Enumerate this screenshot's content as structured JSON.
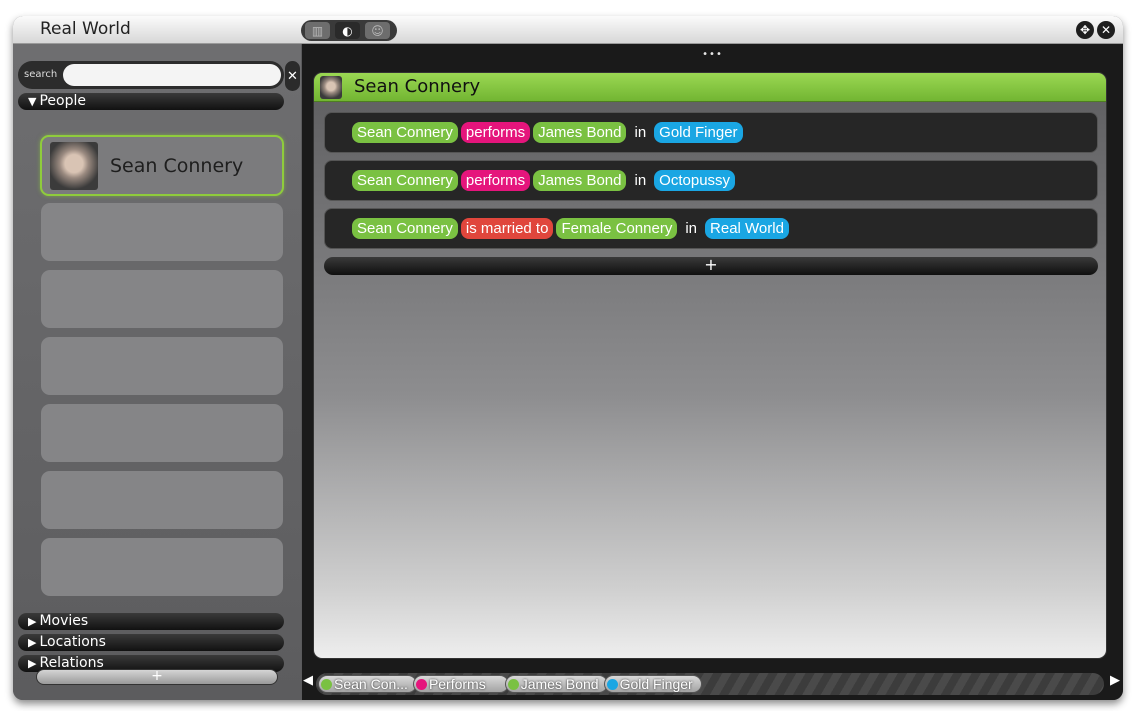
{
  "window": {
    "title": "Real World"
  },
  "view_toggle": {
    "icons": [
      "panels-icon",
      "contrast-icon",
      "user-icon"
    ]
  },
  "window_controls": {
    "move_icon": "move-icon",
    "close_icon": "close-icon"
  },
  "sidebar": {
    "search": {
      "label": "search",
      "value": "",
      "placeholder": ""
    },
    "categories": [
      {
        "label": "People",
        "expanded": true
      },
      {
        "label": "Movies",
        "expanded": false
      },
      {
        "label": "Locations",
        "expanded": false
      },
      {
        "label": "Relations",
        "expanded": false
      }
    ],
    "people": [
      {
        "name": "Sean Connery",
        "selected": true
      }
    ],
    "add_label": "+"
  },
  "main": {
    "drag_handle": "•••",
    "entity": {
      "name": "Sean Connery"
    },
    "relations": [
      {
        "subject": "Sean Connery",
        "predicate": "performs",
        "object": "James Bond",
        "in_word": "in",
        "context": "Gold Finger",
        "predicate_color": "#e5157c"
      },
      {
        "subject": "Sean Connery",
        "predicate": "performs",
        "object": "James Bond",
        "in_word": "in",
        "context": "Octopussy",
        "predicate_color": "#e5157c"
      },
      {
        "subject": "Sean Connery",
        "predicate": "is married to",
        "object": "Female Connery",
        "in_word": "in",
        "context": "Real World",
        "predicate_color": "#e0463c"
      }
    ],
    "add_label": "+",
    "breadcrumbs": [
      {
        "label": "Sean Con...",
        "color": "#7ac142"
      },
      {
        "label": "Performs",
        "color": "#e5157c"
      },
      {
        "label": "James Bond",
        "color": "#7ac142"
      },
      {
        "label": "Gold Finger",
        "color": "#1aa6e3"
      }
    ]
  },
  "colors": {
    "entity_green": "#7ac142",
    "context_blue": "#1aa6e3",
    "selection_border": "#8fcc3c"
  }
}
